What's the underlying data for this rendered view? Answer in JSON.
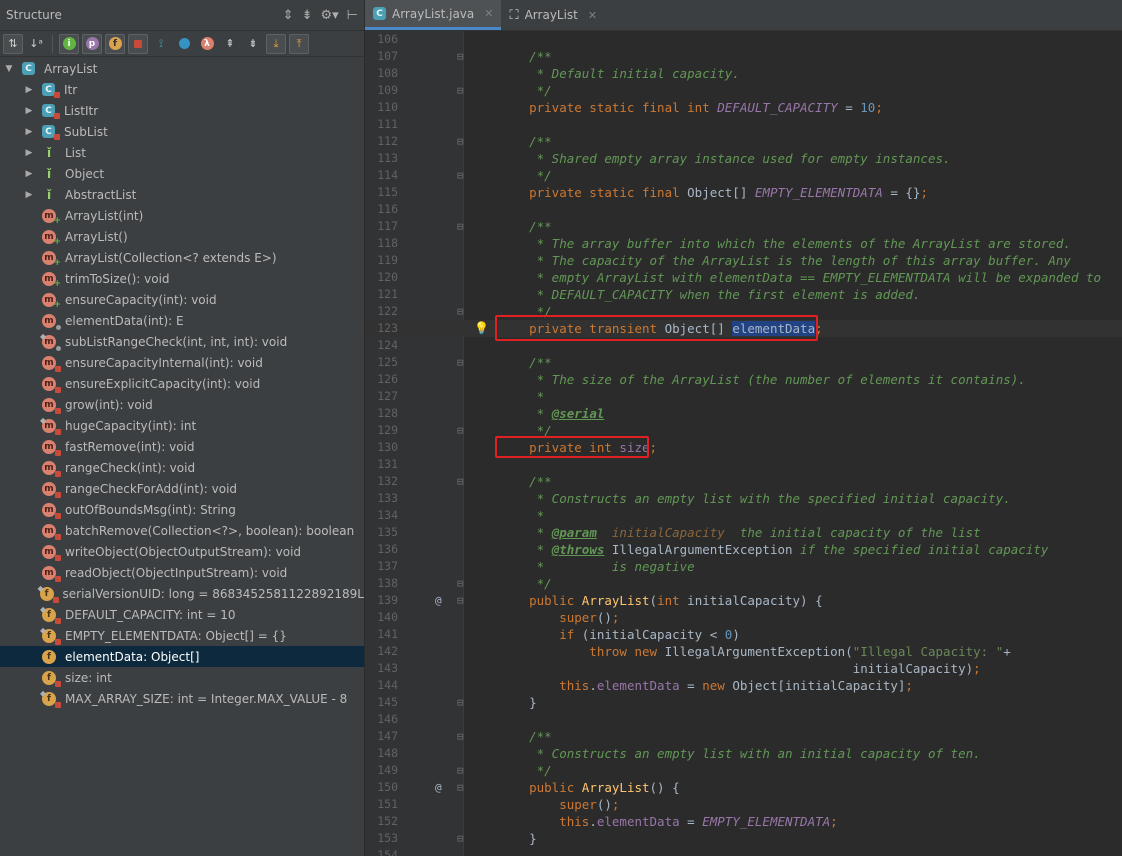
{
  "structure": {
    "title": "Structure",
    "tree": [
      {
        "label": "ArrayList",
        "kind": "class",
        "level": 0,
        "arrow": "▼"
      },
      {
        "label": "Itr",
        "kind": "class",
        "mod": "lock",
        "level": 1,
        "arrow": "▶"
      },
      {
        "label": "ListItr",
        "kind": "class",
        "mod": "lock",
        "level": 1,
        "arrow": "▶"
      },
      {
        "label": "SubList",
        "kind": "class",
        "mod": "lock",
        "level": 1,
        "arrow": "▶"
      },
      {
        "label": "List",
        "kind": "interface",
        "level": 1,
        "arrow": "▶"
      },
      {
        "label": "Object",
        "kind": "interface",
        "level": 1,
        "arrow": "▶"
      },
      {
        "label": "AbstractList",
        "kind": "interface",
        "level": 1,
        "arrow": "▶"
      },
      {
        "label": "ArrayList(int)",
        "kind": "method",
        "mod": "plus",
        "level": 1
      },
      {
        "label": "ArrayList()",
        "kind": "method",
        "mod": "plus",
        "level": 1
      },
      {
        "label": "ArrayList(Collection<? extends E>)",
        "kind": "method",
        "mod": "plus",
        "level": 1
      },
      {
        "label": "trimToSize(): void",
        "kind": "method",
        "mod": "plus",
        "level": 1
      },
      {
        "label": "ensureCapacity(int): void",
        "kind": "method",
        "mod": "plus",
        "level": 1
      },
      {
        "label": "elementData(int): E",
        "kind": "method",
        "mod": "dot",
        "level": 1
      },
      {
        "label": "subListRangeCheck(int, int, int): void",
        "kind": "method",
        "mod": "dot",
        "pin": true,
        "level": 1
      },
      {
        "label": "ensureCapacityInternal(int): void",
        "kind": "method",
        "mod": "lock",
        "level": 1
      },
      {
        "label": "ensureExplicitCapacity(int): void",
        "kind": "method",
        "mod": "lock",
        "level": 1
      },
      {
        "label": "grow(int): void",
        "kind": "method",
        "mod": "lock",
        "level": 1
      },
      {
        "label": "hugeCapacity(int): int",
        "kind": "method",
        "mod": "lock",
        "pin": true,
        "level": 1
      },
      {
        "label": "fastRemove(int): void",
        "kind": "method",
        "mod": "lock",
        "level": 1
      },
      {
        "label": "rangeCheck(int): void",
        "kind": "method",
        "mod": "lock",
        "level": 1
      },
      {
        "label": "rangeCheckForAdd(int): void",
        "kind": "method",
        "mod": "lock",
        "level": 1
      },
      {
        "label": "outOfBoundsMsg(int): String",
        "kind": "method",
        "mod": "lock",
        "level": 1
      },
      {
        "label": "batchRemove(Collection<?>, boolean): boolean",
        "kind": "method",
        "mod": "lock",
        "level": 1
      },
      {
        "label": "writeObject(ObjectOutputStream): void",
        "kind": "method",
        "mod": "lock",
        "level": 1
      },
      {
        "label": "readObject(ObjectInputStream): void",
        "kind": "method",
        "mod": "lock",
        "level": 1
      },
      {
        "label": "serialVersionUID: long = 8683452581122892189L",
        "kind": "field",
        "mod": "lock",
        "pin": true,
        "level": 1
      },
      {
        "label": "DEFAULT_CAPACITY: int = 10",
        "kind": "field",
        "mod": "lock",
        "pin": true,
        "level": 1
      },
      {
        "label": "EMPTY_ELEMENTDATA: Object[] = {}",
        "kind": "field",
        "mod": "lock",
        "pin": true,
        "level": 1
      },
      {
        "label": "elementData: Object[]",
        "kind": "field",
        "level": 1,
        "selected": true
      },
      {
        "label": "size: int",
        "kind": "field",
        "mod": "lock",
        "level": 1
      },
      {
        "label": "MAX_ARRAY_SIZE: int = Integer.MAX_VALUE - 8",
        "kind": "field",
        "mod": "lock",
        "pin": true,
        "level": 1
      }
    ]
  },
  "tabs": [
    {
      "label": "ArrayList.java",
      "icon": "class-icon",
      "active": true
    },
    {
      "label": "ArrayList",
      "icon": "hierarchy-icon",
      "active": false
    }
  ],
  "code": [
    {
      "n": "106",
      "s": []
    },
    {
      "n": "107",
      "fold": true,
      "s": [
        [
          "cm",
          "    /**"
        ]
      ]
    },
    {
      "n": "108",
      "s": [
        [
          "cm",
          "     * Default initial capacity."
        ]
      ]
    },
    {
      "n": "109",
      "fold": true,
      "s": [
        [
          "cm",
          "     */"
        ]
      ]
    },
    {
      "n": "110",
      "s": [
        [
          "kw",
          "    private static final int "
        ],
        [
          "st",
          "DEFAULT_CAPACITY"
        ],
        [
          "",
          " = "
        ],
        [
          "num",
          "10"
        ],
        [
          "kw",
          ";"
        ]
      ]
    },
    {
      "n": "111",
      "s": []
    },
    {
      "n": "112",
      "fold": true,
      "s": [
        [
          "cm",
          "    /**"
        ]
      ]
    },
    {
      "n": "113",
      "s": [
        [
          "cm",
          "     * Shared empty array instance used for empty instances."
        ]
      ]
    },
    {
      "n": "114",
      "fold": true,
      "s": [
        [
          "cm",
          "     */"
        ]
      ]
    },
    {
      "n": "115",
      "s": [
        [
          "kw",
          "    private static final "
        ],
        [
          "",
          "Object[] "
        ],
        [
          "st",
          "EMPTY_ELEMENTDATA"
        ],
        [
          "",
          " = {}"
        ],
        [
          "kw",
          ";"
        ]
      ]
    },
    {
      "n": "116",
      "s": []
    },
    {
      "n": "117",
      "fold": true,
      "s": [
        [
          "cm",
          "    /**"
        ]
      ]
    },
    {
      "n": "118",
      "s": [
        [
          "cm",
          "     * The array buffer into which the elements of the ArrayList are stored."
        ]
      ]
    },
    {
      "n": "119",
      "s": [
        [
          "cm",
          "     * The capacity of the ArrayList is the length of this array buffer. Any"
        ]
      ]
    },
    {
      "n": "120",
      "s": [
        [
          "cm",
          "     * empty ArrayList with elementData == EMPTY_ELEMENTDATA will be expanded to"
        ]
      ]
    },
    {
      "n": "121",
      "s": [
        [
          "cm",
          "     * DEFAULT_CAPACITY when the first element is added."
        ]
      ]
    },
    {
      "n": "122",
      "fold": true,
      "s": [
        [
          "cm",
          "     */"
        ]
      ]
    },
    {
      "n": "123",
      "bulb": true,
      "current": true,
      "s": [
        [
          "kw",
          "    private transient "
        ],
        [
          "",
          "Object[] "
        ],
        [
          "hl",
          "elementData"
        ],
        [
          "kw",
          ";"
        ]
      ]
    },
    {
      "n": "124",
      "s": []
    },
    {
      "n": "125",
      "fold": true,
      "s": [
        [
          "cm",
          "    /**"
        ]
      ]
    },
    {
      "n": "126",
      "s": [
        [
          "cm",
          "     * The size of the ArrayList (the number of elements it contains)."
        ]
      ]
    },
    {
      "n": "127",
      "s": [
        [
          "cm",
          "     *"
        ]
      ]
    },
    {
      "n": "128",
      "s": [
        [
          "cm",
          "     * "
        ],
        [
          "cmtag",
          "@serial"
        ]
      ]
    },
    {
      "n": "129",
      "fold": true,
      "s": [
        [
          "cm",
          "     */"
        ]
      ]
    },
    {
      "n": "130",
      "s": [
        [
          "kw",
          "    private int "
        ],
        [
          "fld",
          "size"
        ],
        [
          "kw",
          ";"
        ]
      ]
    },
    {
      "n": "131",
      "s": []
    },
    {
      "n": "132",
      "fold": true,
      "s": [
        [
          "cm",
          "    /**"
        ]
      ]
    },
    {
      "n": "133",
      "s": [
        [
          "cm",
          "     * Constructs an empty list with the specified initial capacity."
        ]
      ]
    },
    {
      "n": "134",
      "s": [
        [
          "cm",
          "     *"
        ]
      ]
    },
    {
      "n": "135",
      "s": [
        [
          "cm",
          "     * "
        ],
        [
          "cmtag",
          "@param"
        ],
        [
          "cm",
          "  "
        ],
        [
          "cmparam",
          "initialCapacity"
        ],
        [
          "cm",
          "  the initial capacity of the list"
        ]
      ]
    },
    {
      "n": "136",
      "s": [
        [
          "cm",
          "     * "
        ],
        [
          "cmtag",
          "@throws"
        ],
        [
          "",
          " IllegalArgumentException"
        ],
        [
          "cm",
          " if the specified initial capacity"
        ]
      ]
    },
    {
      "n": "137",
      "s": [
        [
          "cm",
          "     *         is negative"
        ]
      ]
    },
    {
      "n": "138",
      "fold": true,
      "s": [
        [
          "cm",
          "     */"
        ]
      ]
    },
    {
      "n": "139",
      "at": true,
      "fold": true,
      "s": [
        [
          "kw",
          "    public "
        ],
        [
          "mth",
          "ArrayList"
        ],
        [
          "",
          "("
        ],
        [
          "kw",
          "int "
        ],
        [
          "",
          "initialCapacity) {"
        ]
      ]
    },
    {
      "n": "140",
      "s": [
        [
          "kw",
          "        super"
        ],
        [
          "",
          "()"
        ],
        [
          "kw",
          ";"
        ]
      ]
    },
    {
      "n": "141",
      "s": [
        [
          "kw",
          "        if "
        ],
        [
          "",
          "(initialCapacity < "
        ],
        [
          "num",
          "0"
        ],
        [
          "",
          ")"
        ]
      ]
    },
    {
      "n": "142",
      "s": [
        [
          "kw",
          "            throw new "
        ],
        [
          "",
          "IllegalArgumentException("
        ],
        [
          "str",
          "\"Illegal Capacity: \""
        ],
        [
          "",
          "+"
        ]
      ]
    },
    {
      "n": "143",
      "s": [
        [
          "",
          "                                               initialCapacity)"
        ],
        [
          "kw",
          ";"
        ]
      ]
    },
    {
      "n": "144",
      "s": [
        [
          "kw",
          "        this"
        ],
        [
          "",
          "."
        ],
        [
          "fld",
          "elementData"
        ],
        [
          "",
          " = "
        ],
        [
          "kw",
          "new "
        ],
        [
          "",
          "Object[initialCapacity]"
        ],
        [
          "kw",
          ";"
        ]
      ]
    },
    {
      "n": "145",
      "fold": true,
      "s": [
        [
          "",
          "    }"
        ]
      ]
    },
    {
      "n": "146",
      "s": []
    },
    {
      "n": "147",
      "fold": true,
      "s": [
        [
          "cm",
          "    /**"
        ]
      ]
    },
    {
      "n": "148",
      "s": [
        [
          "cm",
          "     * Constructs an empty list with an initial capacity of ten."
        ]
      ]
    },
    {
      "n": "149",
      "fold": true,
      "s": [
        [
          "cm",
          "     */"
        ]
      ]
    },
    {
      "n": "150",
      "at": true,
      "fold": true,
      "s": [
        [
          "kw",
          "    public "
        ],
        [
          "mth",
          "ArrayList"
        ],
        [
          "",
          "() {"
        ]
      ]
    },
    {
      "n": "151",
      "s": [
        [
          "kw",
          "        super"
        ],
        [
          "",
          "()"
        ],
        [
          "kw",
          ";"
        ]
      ]
    },
    {
      "n": "152",
      "s": [
        [
          "kw",
          "        this"
        ],
        [
          "",
          "."
        ],
        [
          "fld",
          "elementData"
        ],
        [
          "",
          " = "
        ],
        [
          "st",
          "EMPTY_ELEMENTDATA"
        ],
        [
          "kw",
          ";"
        ]
      ]
    },
    {
      "n": "153",
      "fold": true,
      "s": [
        [
          "",
          "    }"
        ]
      ]
    },
    {
      "n": "154",
      "s": []
    }
  ],
  "colors": {
    "highlight_box": "#e02121",
    "selection": "#0d293e"
  }
}
